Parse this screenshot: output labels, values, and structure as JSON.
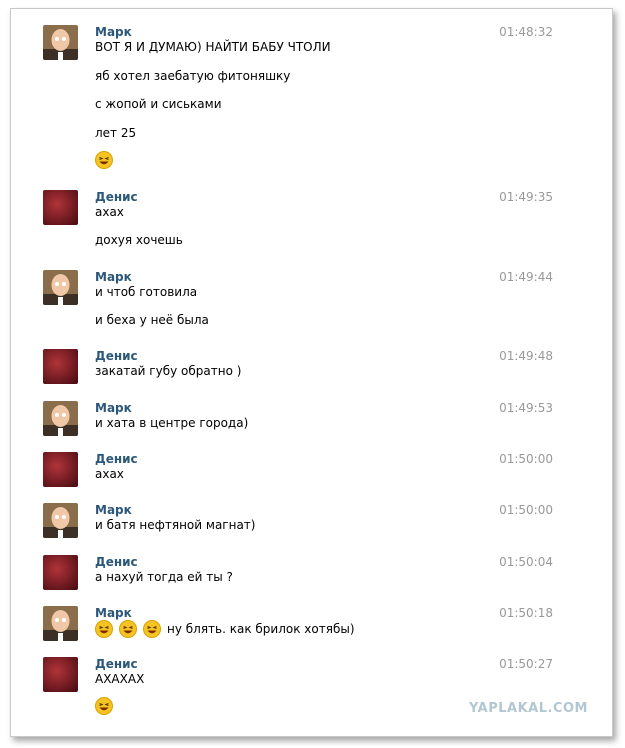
{
  "watermark": "YAPLAKAL.COM",
  "messages": [
    {
      "author": "Марк",
      "time": "01:48:32",
      "lines": [
        "ВОТ Я И ДУМАЮ) НАЙТИ БАБУ ЧТОЛИ",
        "яб хотел заебатую фитоняшку",
        "с жопой и сиськами",
        "лет 25"
      ],
      "emoji_line": {
        "count": 1,
        "text": ""
      }
    },
    {
      "author": "Денис",
      "time": "01:49:35",
      "lines": [
        "ахах",
        "дохуя хочешь"
      ]
    },
    {
      "author": "Марк",
      "time": "01:49:44",
      "lines": [
        "и чтоб готовила",
        "и беха у неё была"
      ]
    },
    {
      "author": "Денис",
      "time": "01:49:48",
      "lines": [
        "закатай губу обратно )"
      ]
    },
    {
      "author": "Марк",
      "time": "01:49:53",
      "lines": [
        "и хата в центре города)"
      ]
    },
    {
      "author": "Денис",
      "time": "01:50:00",
      "lines": [
        "ахах"
      ]
    },
    {
      "author": "Марк",
      "time": "01:50:00",
      "lines": [
        "и батя нефтяной магнат)"
      ]
    },
    {
      "author": "Денис",
      "time": "01:50:04",
      "lines": [
        "а нахуй тогда ей ты ?"
      ]
    },
    {
      "author": "Марк",
      "time": "01:50:18",
      "lines": [],
      "emoji_line": {
        "count": 3,
        "text": "ну блять. как брилок хотябы)"
      }
    },
    {
      "author": "Денис",
      "time": "01:50:27",
      "lines": [
        "АХАХАХ"
      ],
      "emoji_line": {
        "count": 1,
        "text": ""
      }
    }
  ]
}
